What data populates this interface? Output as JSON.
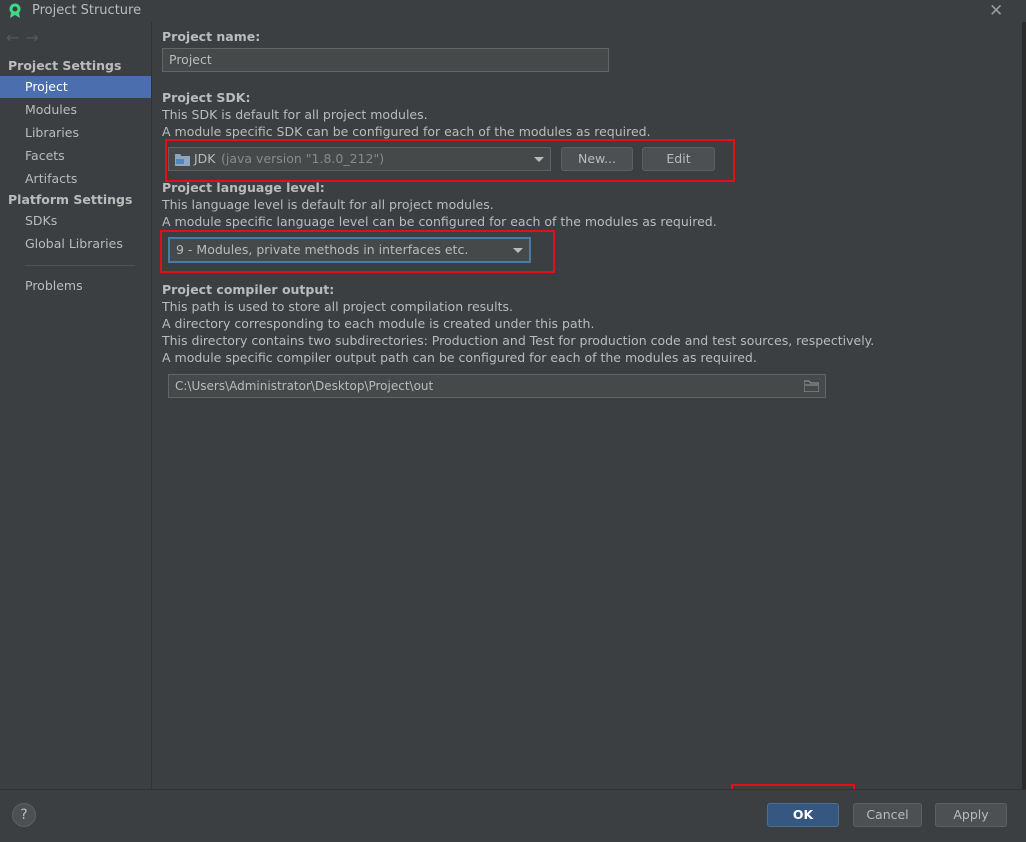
{
  "window": {
    "title": "Project Structure"
  },
  "nav": {
    "back": "←",
    "forward": "→"
  },
  "sidebar": {
    "project_settings_header": "Project Settings",
    "project_items": [
      "Project",
      "Modules",
      "Libraries",
      "Facets",
      "Artifacts"
    ],
    "active_item": "Project",
    "platform_settings_header": "Platform Settings",
    "platform_items": [
      "SDKs",
      "Global Libraries"
    ],
    "problems": "Problems"
  },
  "project_name": {
    "label": "Project name:",
    "value": "Project"
  },
  "sdk": {
    "label": "Project SDK:",
    "desc1": "This SDK is default for all project modules.",
    "desc2": "A module specific SDK can be configured for each of the modules as required.",
    "selected_name": "JDK",
    "selected_version": "(java version \"1.8.0_212\")",
    "new_button": "New...",
    "edit_button": "Edit"
  },
  "language_level": {
    "label": "Project language level:",
    "desc1": "This language level is default for all project modules.",
    "desc2": "A module specific language level can be configured for each of the modules as required.",
    "selected": "9 - Modules, private methods in interfaces etc."
  },
  "compiler_output": {
    "label": "Project compiler output:",
    "desc1": "This path is used to store all project compilation results.",
    "desc2": "A directory corresponding to each module is created under this path.",
    "desc3": "This directory contains two subdirectories: Production and Test for production code and test sources, respectively.",
    "desc4": "A module specific compiler output path can be configured for each of the modules as required.",
    "path": "C:\\Users\\Administrator\\Desktop\\Project\\out"
  },
  "footer": {
    "help": "?",
    "ok": "OK",
    "cancel": "Cancel",
    "apply": "Apply"
  },
  "colors": {
    "accent": "#4b6eaf",
    "primary_button": "#365880",
    "highlight_box": "#e0101a"
  },
  "icons": [
    "app-logo-icon",
    "close-icon",
    "back-arrow-icon",
    "forward-arrow-icon",
    "folder-icon",
    "chevron-down-icon",
    "help-icon"
  ]
}
